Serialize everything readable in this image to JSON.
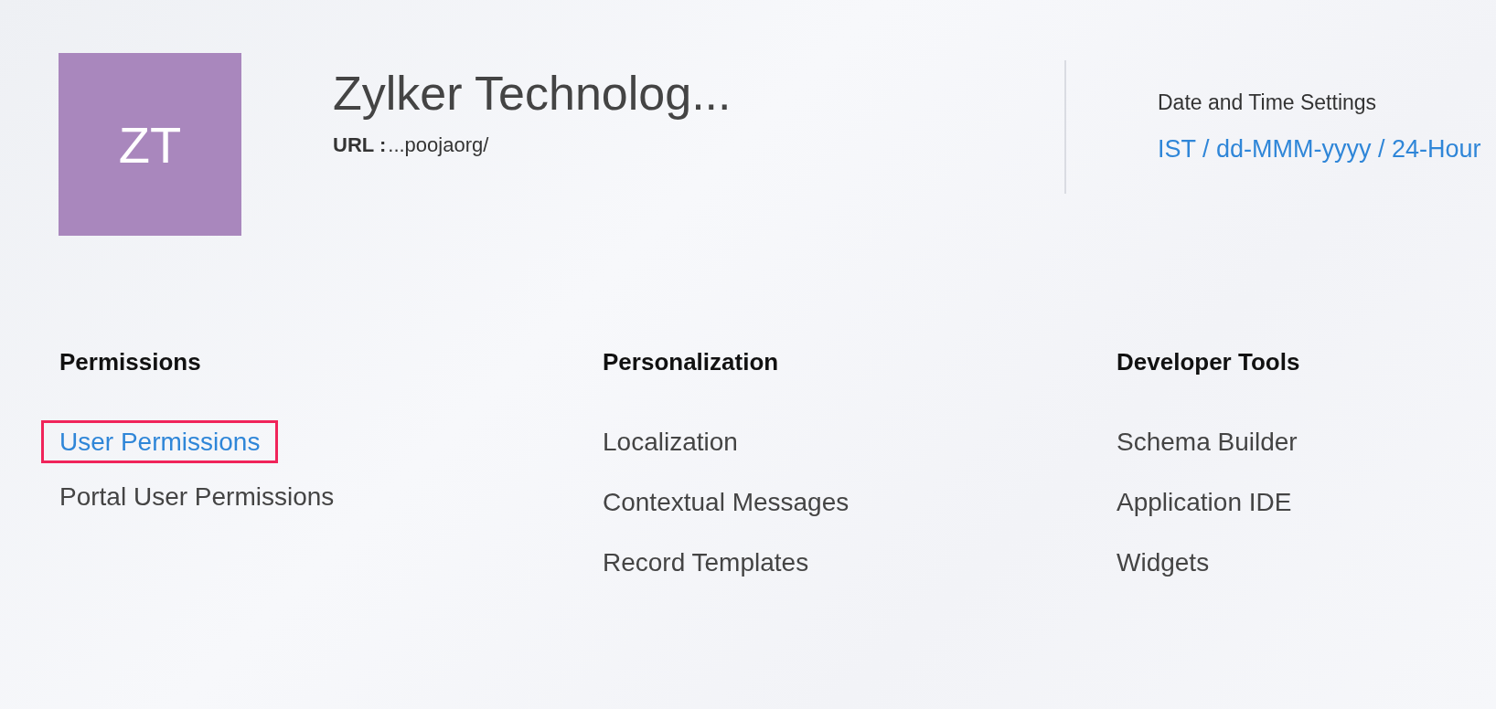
{
  "organization": {
    "initials": "ZT",
    "name": "Zylker Technolog...",
    "url_label": "URL :",
    "url": "...poojaorg/"
  },
  "date_time_settings": {
    "label": "Date and Time Settings",
    "value": "IST / dd-MMM-yyyy / 24-Hour"
  },
  "sections": [
    {
      "title": "Permissions",
      "items": [
        {
          "label": "User Permissions",
          "highlighted": true
        },
        {
          "label": "Portal User Permissions",
          "highlighted": false
        }
      ]
    },
    {
      "title": "Personalization",
      "items": [
        {
          "label": "Localization",
          "highlighted": false
        },
        {
          "label": "Contextual Messages",
          "highlighted": false
        },
        {
          "label": "Record Templates",
          "highlighted": false
        }
      ]
    },
    {
      "title": "Developer Tools",
      "items": [
        {
          "label": "Schema Builder",
          "highlighted": false
        },
        {
          "label": "Application IDE",
          "highlighted": false
        },
        {
          "label": "Widgets",
          "highlighted": false
        }
      ]
    }
  ]
}
